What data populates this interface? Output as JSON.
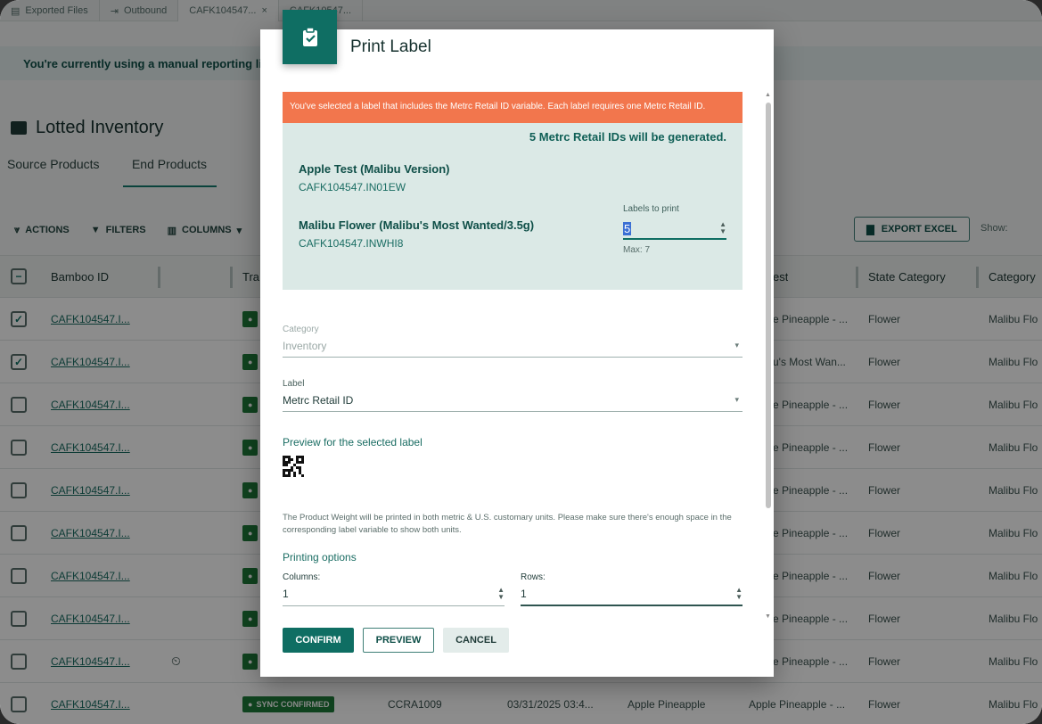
{
  "tabs": [
    {
      "label": "Exported Files",
      "icon": "file-icon"
    },
    {
      "label": "Outbound",
      "icon": "arrow-right-icon"
    },
    {
      "label": "CAFK104547...",
      "closable": true
    },
    {
      "label": "CAFK10547..."
    }
  ],
  "banner": {
    "text": "You're currently using a manual reporting li"
  },
  "page": {
    "title": "Lotted Inventory",
    "subtabs": [
      "Source Products",
      "End Products"
    ],
    "active_subtab": "End Products"
  },
  "toolbar": {
    "actions": "ACTIONS",
    "filters": "FILTERS",
    "columns": "COLUMNS",
    "export": "EXPORT EXCEL",
    "show": "Show:"
  },
  "grid": {
    "headers": {
      "bamboo_id": "Bamboo ID",
      "tra": "Tra",
      "est": "est",
      "state_category": "State Category",
      "category": "Category"
    },
    "rows": [
      {
        "checked": true,
        "id": "CAFK104547.I...",
        "status": "",
        "est": "e Pineapple - ...",
        "state": "Flower",
        "category": "Malibu Flo"
      },
      {
        "checked": true,
        "id": "CAFK104547.I...",
        "status": "",
        "est": "u's Most Wan...",
        "state": "Flower",
        "category": "Malibu Flo"
      },
      {
        "checked": false,
        "id": "CAFK104547.I...",
        "status": "",
        "est": "e Pineapple - ...",
        "state": "Flower",
        "category": "Malibu Flo"
      },
      {
        "checked": false,
        "id": "CAFK104547.I...",
        "status": "",
        "est": "e Pineapple - ...",
        "state": "Flower",
        "category": "Malibu Flo"
      },
      {
        "checked": false,
        "id": "CAFK104547.I...",
        "status": "",
        "est": "e Pineapple - ...",
        "state": "Flower",
        "category": "Malibu Flo"
      },
      {
        "checked": false,
        "id": "CAFK104547.I...",
        "status": "",
        "est": "e Pineapple - ...",
        "state": "Flower",
        "category": "Malibu Flo"
      },
      {
        "checked": false,
        "id": "CAFK104547.I...",
        "status": "",
        "est": "e Pineapple - ...",
        "state": "Flower",
        "category": "Malibu Flo"
      },
      {
        "checked": false,
        "id": "CAFK104547.I...",
        "status": "",
        "est": "e Pineapple - ...",
        "state": "Flower",
        "category": "Malibu Flo"
      },
      {
        "checked": false,
        "id": "CAFK104547.I...",
        "status": "",
        "est": "e Pineapple - ...",
        "state": "Flower",
        "category": "Malibu Flo"
      },
      {
        "checked": false,
        "id": "CAFK104547.I...",
        "status": "SYNC CONFIRMED",
        "ccra": "CCRA1009",
        "date": "03/31/2025 03:4...",
        "product": "Apple Pineapple",
        "est": "Apple Pineapple - ...",
        "state": "Flower",
        "category": "Malibu Flo"
      }
    ]
  },
  "modal": {
    "title": "Print Label",
    "warning": "You've selected a label that includes the Metrc Retail ID variable. Each label requires one Metrc Retail ID.",
    "generated": "5 Metrc Retail IDs will be generated.",
    "products": [
      {
        "name": "Apple Test (Malibu Version)",
        "id": "CAFK104547.IN01EW"
      },
      {
        "name": "Malibu Flower (Malibu's Most Wanted/3.5g)",
        "id": "CAFK104547.INWHI8"
      }
    ],
    "labels_to_print": {
      "label": "Labels to print",
      "value": "5",
      "max": "Max: 7"
    },
    "category": {
      "label": "Category",
      "value": "Inventory"
    },
    "label_field": {
      "label": "Label",
      "value": "Metrc Retail ID"
    },
    "preview_title": "Preview for the selected label",
    "note": "The Product Weight will be printed in both metric & U.S. customary units. Please make sure there's enough space in the corresponding label variable to show both units.",
    "printing_options": "Printing options",
    "columns": {
      "label": "Columns:",
      "value": "1"
    },
    "rows": {
      "label": "Rows:",
      "value": "1"
    },
    "buttons": {
      "confirm": "CONFIRM",
      "preview": "PREVIEW",
      "cancel": "CANCEL"
    }
  },
  "colors": {
    "brand": "#0f6e63",
    "warning": "#f2764d",
    "info_bg": "#dbe9e6"
  }
}
